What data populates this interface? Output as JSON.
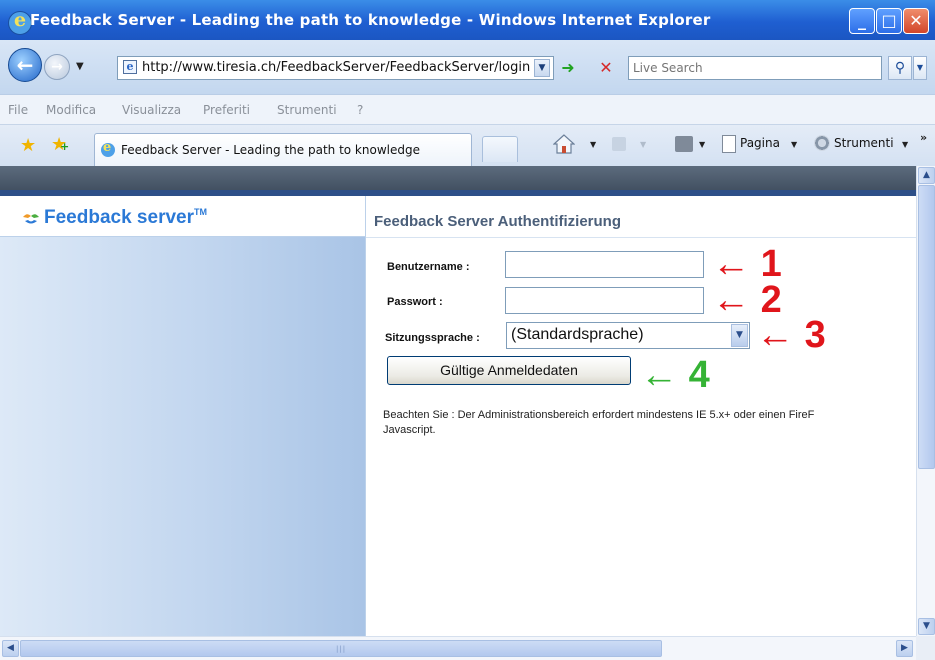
{
  "window": {
    "title": "Feedback Server - Leading the path to knowledge - Windows Internet Explorer",
    "min_label": "_",
    "max_label": "□",
    "close_label": "✕"
  },
  "addressbar": {
    "url": "http://www.tiresia.ch/FeedbackServer/FeedbackServer/login",
    "search_placeholder": "Live Search"
  },
  "menubar": {
    "items": [
      "File",
      "Modifica",
      "Visualizza",
      "Preferiti",
      "Strumenti",
      "?"
    ]
  },
  "tabbar": {
    "active_tab_label": "Feedback Server - Leading the path to knowledge",
    "page_menu_label": "Pagina",
    "tools_menu_label": "Strumenti"
  },
  "page": {
    "logo_text": "Feedback server",
    "logo_tm": "TM",
    "auth_title": "Feedback Server Authentifizierung",
    "username_label": "Benutzername :",
    "username_value": "",
    "password_label": "Passwort :",
    "password_value": "",
    "language_label": "Sitzungssprache :",
    "language_selected": "(Standardsprache)",
    "submit_label": "Gültige Anmeldedaten",
    "note_line1": "Beachten Sie : Der Administrationsbereich erfordert mindestens IE 5.x+ oder einen FireF",
    "note_line2": "Javascript."
  },
  "annotations": [
    {
      "number": "1",
      "color": "#e0151b"
    },
    {
      "number": "2",
      "color": "#e0151b"
    },
    {
      "number": "3",
      "color": "#e0151b"
    },
    {
      "number": "4",
      "color": "#35b335"
    }
  ],
  "colors": {
    "titlebar": "#1f5fd1",
    "logo_blue": "#2b79d6",
    "annotation_red": "#e0151b",
    "annotation_green": "#35b335"
  }
}
